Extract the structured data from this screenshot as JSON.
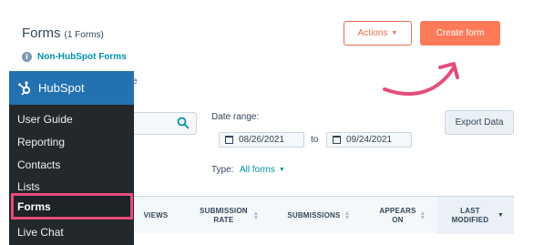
{
  "header": {
    "title": "Forms",
    "count": "(1 Forms)",
    "non_hubspot_link": "Non-HubSpot Forms",
    "info_glyph": "i",
    "partial_tab_text": "ze"
  },
  "buttons": {
    "actions": "Actions",
    "create": "Create form",
    "export": "Export Data"
  },
  "filters": {
    "date_range_label": "Date range:",
    "date_from": "08/26/2021",
    "date_separator": "to",
    "date_to": "09/24/2021",
    "type_label": "Type:",
    "type_value": "All forms"
  },
  "table": {
    "columns": [
      "VIEWS",
      "SUBMISSION RATE",
      "SUBMISSIONS",
      "APPEARS ON",
      "LAST MODIFIED"
    ]
  },
  "sidebar": {
    "title": "HubSpot",
    "items": [
      "User Guide",
      "Reporting",
      "Contacts",
      "Lists",
      "Forms",
      "Live Chat"
    ],
    "active_item": "Forms"
  },
  "icons": {
    "search": "search-icon",
    "calendar": "calendar-icon",
    "info": "info-icon",
    "logo": "hubspot-logo-icon",
    "annotation": "curved-arrow-icon"
  },
  "colors": {
    "primary": "#ff7a59",
    "accent_link": "#0091ae",
    "sidebar_bg": "#23282d",
    "sidebar_header": "#2271b1",
    "highlight": "#e64d7a"
  }
}
